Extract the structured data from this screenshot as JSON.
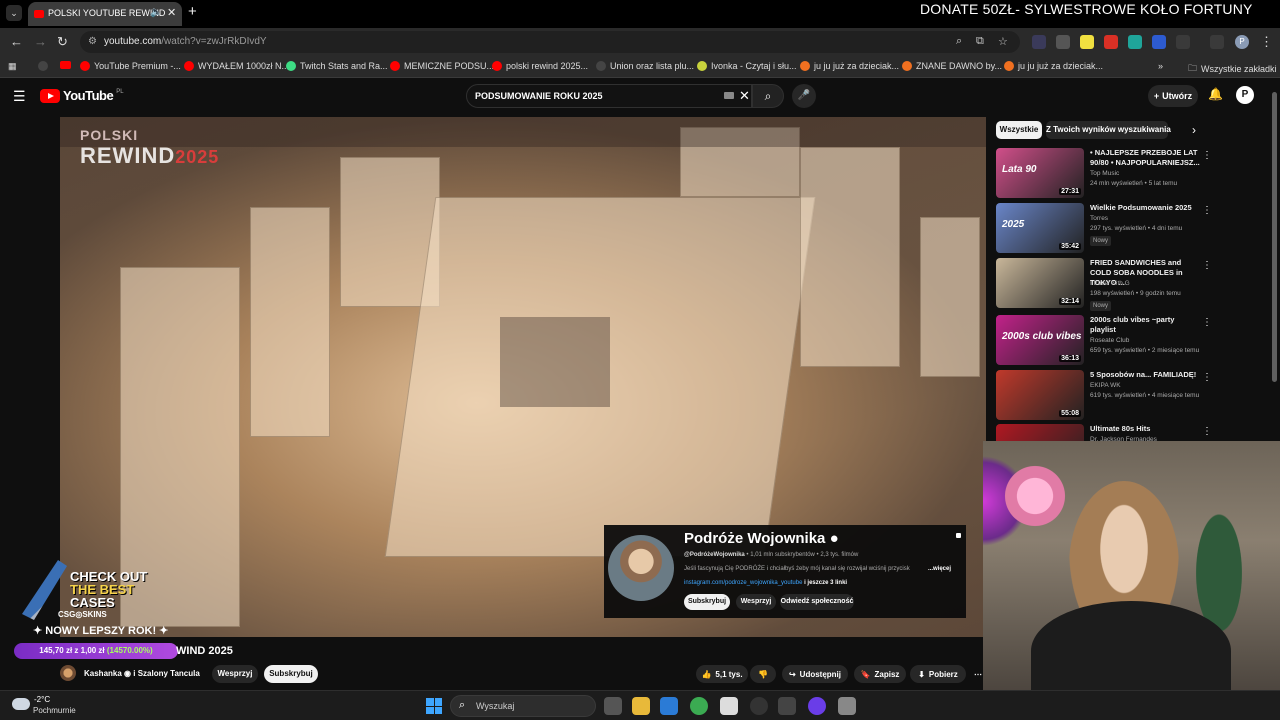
{
  "browser": {
    "tab": {
      "title": "POLSKI YOUTUBE REWIND",
      "favicon": "youtube-favicon",
      "audio_icon": "speaker-icon"
    },
    "overlay_text": "DONATE 50ZŁ- SYLWESTROWE KOŁO FORTUNY",
    "address": {
      "host": "youtube.com",
      "path": "/watch?v=zwJrRkDIvdY"
    },
    "profile_initial": "P",
    "bookmarks": [
      {
        "label": "YouTube Premium -...",
        "color": "#ff0000"
      },
      {
        "label": "WYDAŁEM 1000zł N...",
        "color": "#ff0000"
      },
      {
        "label": "Twitch Stats and Ra...",
        "color": "#3ddc84"
      },
      {
        "label": "MEMICZNE PODSU...",
        "color": "#ff0000"
      },
      {
        "label": "polski rewind 2025...",
        "color": "#ff0000"
      },
      {
        "label": "Union oraz lista plu...",
        "color": "#444444"
      },
      {
        "label": "Ivonka - Czytaj i słu...",
        "color": "#c8d23c"
      },
      {
        "label": "ju ju już za dzieciak...",
        "color": "#f07020"
      },
      {
        "label": "ZNANE DAWNO by...",
        "color": "#f07020"
      },
      {
        "label": "ju ju już za dzieciak...",
        "color": "#f07020"
      }
    ],
    "all_bookmarks": "Wszystkie zakładki"
  },
  "youtube": {
    "logo_word": "YouTube",
    "logo_country": "PL",
    "search_value": "PODSUMOWANIE ROKU 2025",
    "create_label": "Utwórz",
    "avatar_initial": "P"
  },
  "player": {
    "watermark": {
      "top": "POLSKI",
      "rewind": "REWIND",
      "year": "2025"
    },
    "card": {
      "name": "Podróże Wojownika",
      "handle": "@PodróżeWojownika",
      "subs": "1,01 mln subskrybentów",
      "videos": "2,3 tys. filmów",
      "description": "Jeśli fascynują Cię PODRÓŻE i chciałbyś żeby mój kanał się rozwijał wciśnij przycisk",
      "more": "...więcej",
      "link": "instagram.com/podroze_wojownika_youtube",
      "link_more": "i jeszcze 3 linki",
      "buttons": [
        "Subskrybuj",
        "Wesprzyj",
        "Odwiedź społeczność"
      ]
    },
    "ad": {
      "line1": "CHECK OUT",
      "line2": "THE BEST",
      "line3": "CASES",
      "brand": "CSG◎SKINS"
    },
    "stream_banner": "NOWY LEPSZY ROK!",
    "goal": {
      "text": "145,70 zł z 1,00 zł",
      "percent": "(14570.00%)"
    }
  },
  "video": {
    "title": "WIND 2025",
    "owner": "Kashanka",
    "owner_collab": "i Szalony Tancula",
    "join": "Wesprzyj",
    "subscribe": "Subskrybuj",
    "likes": "5,1 tys.",
    "share": "Udostępnij",
    "save": "Zapisz",
    "download": "Pobierz"
  },
  "sidebar": {
    "chips": [
      "Wszystkie",
      "Z Twoich wyników wyszukiwania"
    ],
    "items": [
      {
        "title": "• NAJLEPSZE PRZEBOJE LAT 90/80 • NAJPOPULARNIEJSZ...",
        "channel": "Top Music",
        "meta": "24 mln wyświetleń • 5 lat temu",
        "badge": "",
        "duration": "27:31",
        "thumb_label": "Lata 90",
        "thumb_color": "#d14f8a"
      },
      {
        "title": "Wielkie Podsumowanie 2025",
        "channel": "Torres",
        "meta": "297 tys. wyświetleń • 4 dni temu",
        "badge": "Nowy",
        "duration": "35:42",
        "thumb_label": "2025",
        "thumb_color": "#6a86c9"
      },
      {
        "title": "FRIED SANDWICHES and COLD SOBA NOODLES in TOKYO ...",
        "channel": "I travel with G",
        "meta": "198 wyświetleń • 9 godzin temu",
        "badge": "Nowy",
        "duration": "32:14",
        "thumb_label": "",
        "thumb_color": "#c9b79a"
      },
      {
        "title": "2000s club vibes ~party playlist",
        "channel": "Roseate Club",
        "meta": "659 tys. wyświetleń • 2 miesiące temu",
        "badge": "",
        "duration": "36:13",
        "thumb_label": "2000s club vibes",
        "thumb_color": "#c2228a"
      },
      {
        "title": "5 Sposobów na... FAMILIADĘ!",
        "channel": "EKIPA WK",
        "meta": "619 tys. wyświetleń • 4 miesiące temu",
        "badge": "",
        "duration": "55:08",
        "thumb_label": "",
        "thumb_color": "#c0392b"
      },
      {
        "title": "Ultimate 80s Hits",
        "channel": "Dr. Jackson Fernandes",
        "meta": "",
        "badge": "",
        "duration": "",
        "thumb_label": "80s",
        "thumb_color": "#b01822"
      }
    ]
  },
  "taskbar": {
    "temp": "-2°C",
    "condition": "Pochmurnie",
    "search": "Wyszukaj"
  }
}
